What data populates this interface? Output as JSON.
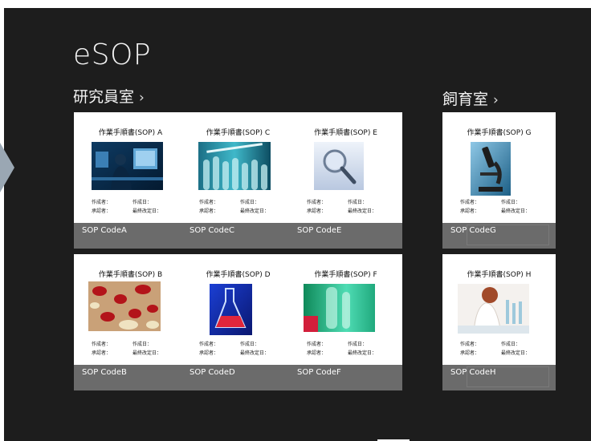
{
  "app": {
    "title": "eSOP"
  },
  "groups": [
    {
      "title": "研究員室",
      "chevron": "›"
    },
    {
      "title": "飼育室",
      "chevron": "›"
    }
  ],
  "labels": {
    "author": "作成者：",
    "created": "作成日：",
    "approver": "承認者：",
    "revised": "最終改定日："
  },
  "tiles": [
    {
      "doc": "作業手順書(SOP) A",
      "code": "SOP CodeA",
      "image": "lab-computers-photo"
    },
    {
      "doc": "作業手順書(SOP) C",
      "code": "SOP CodeC",
      "image": "test-tubes-photo"
    },
    {
      "doc": "作業手順書(SOP) E",
      "code": "SOP CodeE",
      "image": "magnifier-photo"
    },
    {
      "doc": "作業手順書(SOP) G",
      "code": "SOP CodeG",
      "image": "microscope-photo"
    },
    {
      "doc": "作業手順書(SOP) B",
      "code": "SOP CodeB",
      "image": "blood-cells-photo"
    },
    {
      "doc": "作業手順書(SOP) D",
      "code": "SOP CodeD",
      "image": "flask-photo"
    },
    {
      "doc": "作業手順書(SOP) F",
      "code": "SOP CodeF",
      "image": "green-lab-photo"
    },
    {
      "doc": "作業手順書(SOP) H",
      "code": "SOP CodeH",
      "image": "scientist-photo"
    }
  ]
}
